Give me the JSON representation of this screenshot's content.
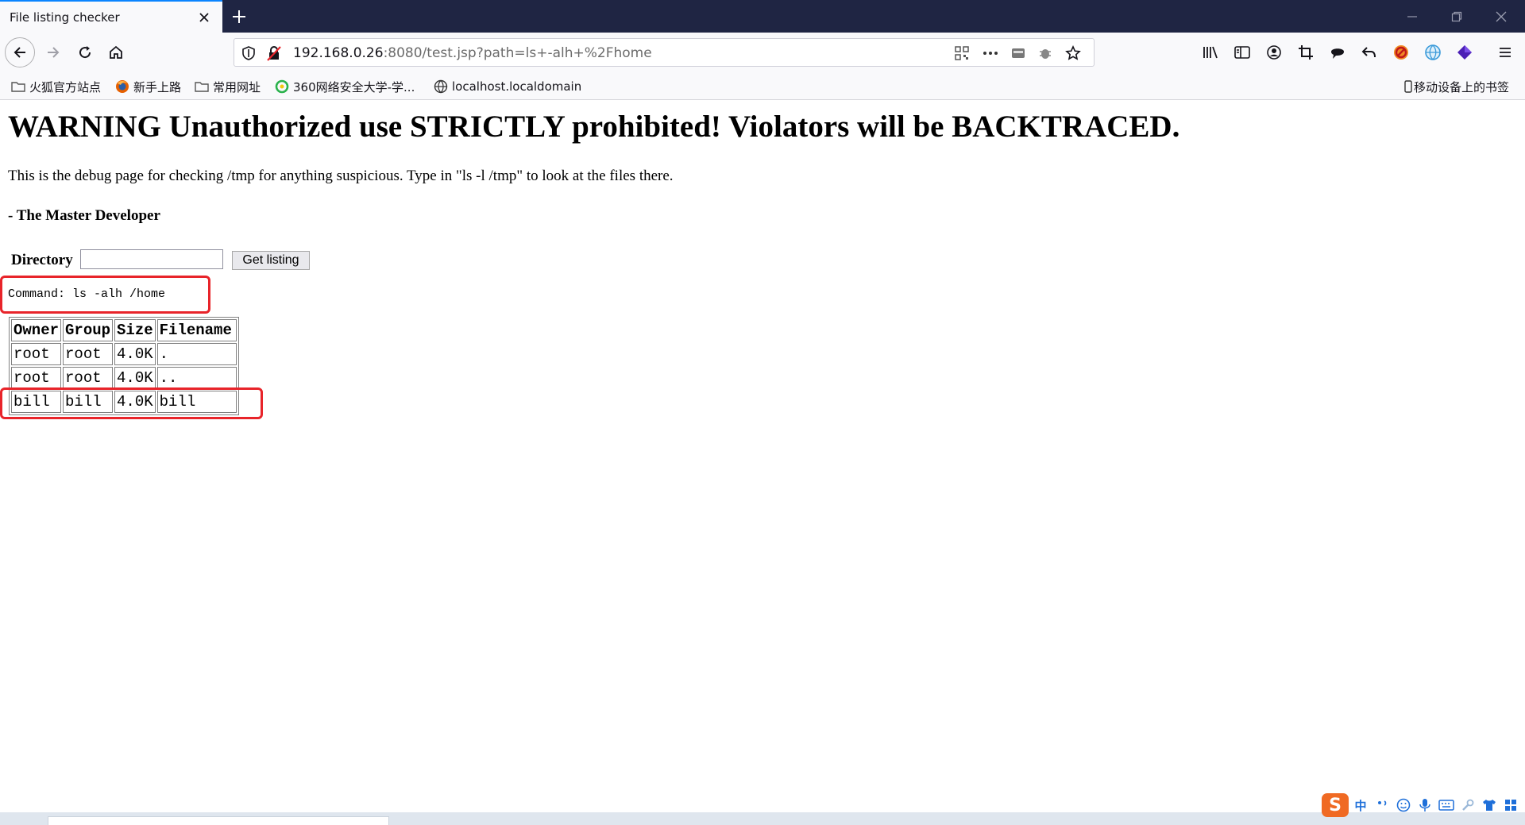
{
  "browser": {
    "tab_title": "File listing checker",
    "url_host": "192.168.0.26",
    "url_rest": ":8080/test.jsp?path=ls+-alh+%2Fhome"
  },
  "bookmarks": {
    "items": [
      {
        "label": "火狐官方站点",
        "icon": "folder-icon"
      },
      {
        "label": "新手上路",
        "icon": "firefox-icon"
      },
      {
        "label": "常用网址",
        "icon": "folder-icon"
      },
      {
        "label": "360网络安全大学-学...",
        "icon": "360-icon"
      },
      {
        "label": "localhost.localdomain",
        "icon": "globe-icon"
      }
    ],
    "mobile": "移动设备上的书签"
  },
  "page": {
    "warning": "WARNING Unauthorized use STRICTLY prohibited! Violators will be BACKTRACED.",
    "intro": "This is the debug page for checking /tmp for anything suspicious. Type in \"ls -l /tmp\" to look at the files there.",
    "signature": "- The Master Developer",
    "directory_label": "Directory",
    "directory_value": "",
    "button_label": "Get listing",
    "command": "Command: ls -alh /home"
  },
  "listing": {
    "headers": [
      "Owner",
      "Group",
      "Size",
      "Filename"
    ],
    "rows": [
      [
        "root",
        "root",
        "4.0K",
        "."
      ],
      [
        "root",
        "root",
        "4.0K",
        ".."
      ],
      [
        "bill",
        "bill",
        "4.0K",
        "bill"
      ]
    ]
  },
  "ime": {
    "logo": "S",
    "mode": "中"
  },
  "colors": {
    "titlebar": "#1f2543",
    "highlight": "#e8242a",
    "accent": "#0a84ff"
  }
}
